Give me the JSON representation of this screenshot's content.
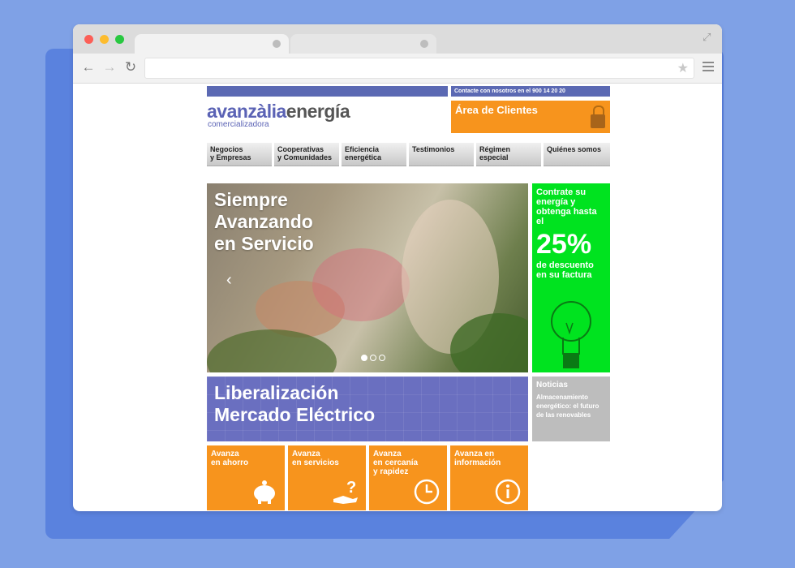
{
  "browser": {
    "menu_icon": "hamburger-menu-icon",
    "star_icon": "bookmark-star-icon"
  },
  "site": {
    "contact_text": "Contacte con nosotros en el 900 14 20 20",
    "logo_avanzalia": "avanzàlia",
    "logo_energia": "energía",
    "logo_sub": "comercializadora",
    "clientes_label": "Área de Clientes",
    "nav": [
      "Negocios\ny Empresas",
      "Cooperativas\ny Comunidades",
      "Eficiencia\nenergética",
      "Testimonios",
      "Régimen\nespecial",
      "Quiénes somos"
    ],
    "hero_title": "Siempre\nAvanzando\nen Servicio",
    "promo_t1": "Contrate su energía y obtenga hasta el",
    "promo_pct": "25%",
    "promo_t2": "de descuento en su factura",
    "lib_title": "Liberalización\nMercado Eléctrico",
    "news_heading": "Noticias",
    "news_text": "Almacenamiento energético: el futuro de las renovables",
    "tiles": [
      {
        "label": "Avanza\nen ahorro",
        "icon": "piggy-bank-icon"
      },
      {
        "label": "Avanza\nen servicios",
        "icon": "hand-question-icon"
      },
      {
        "label": "Avanza\nen cercanía\ny rapidez",
        "icon": "clock-icon"
      },
      {
        "label": "Avanza en\ninformación",
        "icon": "info-icon"
      }
    ]
  },
  "colors": {
    "brand_blue": "#5b69b3",
    "orange": "#f7941d",
    "green": "#00e31f",
    "grey": "#bdbdbd"
  }
}
